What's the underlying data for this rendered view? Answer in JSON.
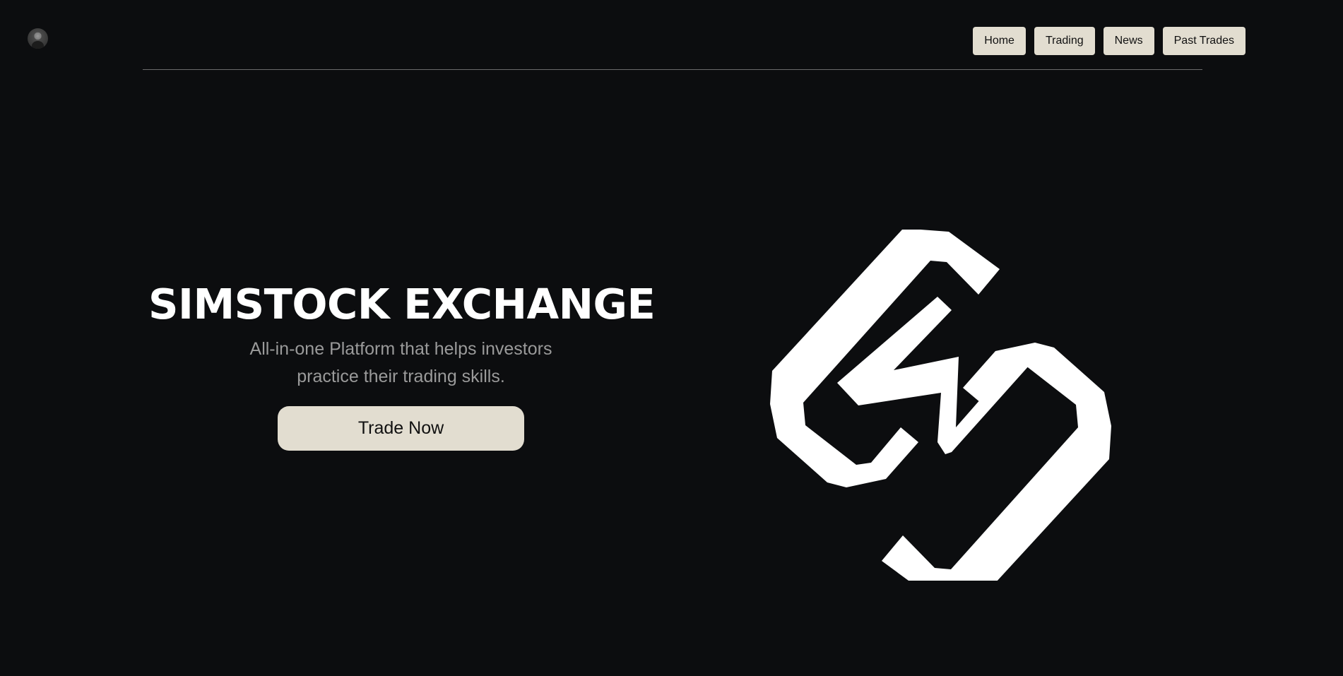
{
  "header": {
    "avatar_icon": "user-avatar",
    "nav": [
      {
        "label": "Home"
      },
      {
        "label": "Trading"
      },
      {
        "label": "News"
      },
      {
        "label": "Past Trades"
      }
    ]
  },
  "hero": {
    "title": "SIMSTOCK EXCHANGE",
    "subtitle": "All-in-one Platform that helps investors practice their trading skills.",
    "cta_label": "Trade Now"
  },
  "logo": {
    "icon": "simstock-logo-icon",
    "color": "#ffffff"
  },
  "colors": {
    "background": "#0c0d0f",
    "button_bg": "#e2ddd0",
    "subtitle": "#9a9a9a",
    "divider": "#6b6b6b"
  }
}
